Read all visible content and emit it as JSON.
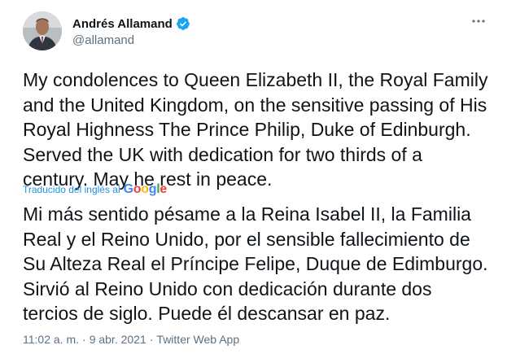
{
  "author": {
    "name": "Andrés Allamand",
    "handle": "@allamand",
    "verified": true,
    "avatar_icon": "avatar-photo"
  },
  "tweet": {
    "text": "My condolences to Queen Elizabeth II, the Royal Family and the United Kingdom, on the sensitive passing of His Royal Highness The Prince Philip, Duke of Edinburgh. Served the UK with dedication for two thirds of a century. May he rest in peace.",
    "translated_label": "Traducido del inglés al",
    "translation_provider": "Google",
    "translated_text": "Mi más sentido pésame a la Reina Isabel II, la Familia Real y el Reino Unido, por el sensible fallecimiento de Su Alteza Real el Príncipe Felipe, Duque de Edimburgo. Sirvió al Reino Unido con dedicación durante dos tercios de siglo. Puede él descansar en paz."
  },
  "meta": {
    "time": "11:02 a. m.",
    "date": "9 abr. 2021",
    "source": "Twitter Web App",
    "separator": "·"
  },
  "colors": {
    "link": "#1b95e0",
    "muted": "#5b7083",
    "verified": "#1da1f2",
    "google_blue": "#4285F4",
    "google_red": "#EA4335",
    "google_yellow": "#FBBC05",
    "google_green": "#34A853"
  },
  "more_icon": "ellipsis-icon"
}
